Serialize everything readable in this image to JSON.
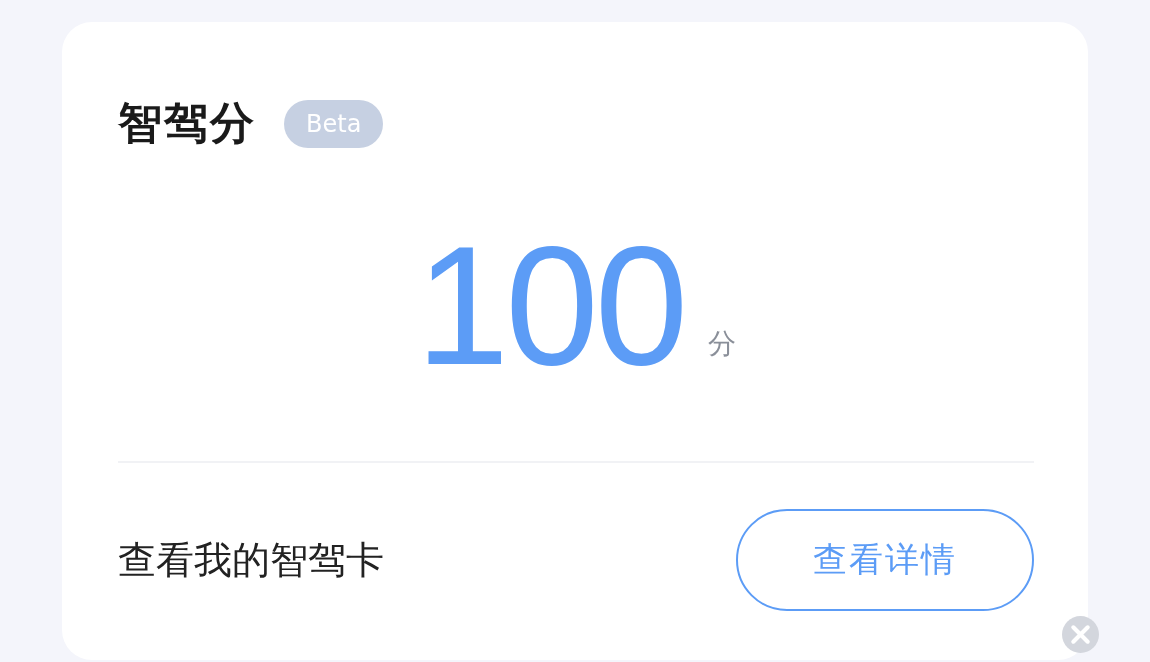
{
  "card": {
    "title": "智驾分",
    "badge": "Beta",
    "score": "100",
    "unit": "分",
    "link_text": "查看我的智驾卡",
    "button": "查看详情"
  }
}
